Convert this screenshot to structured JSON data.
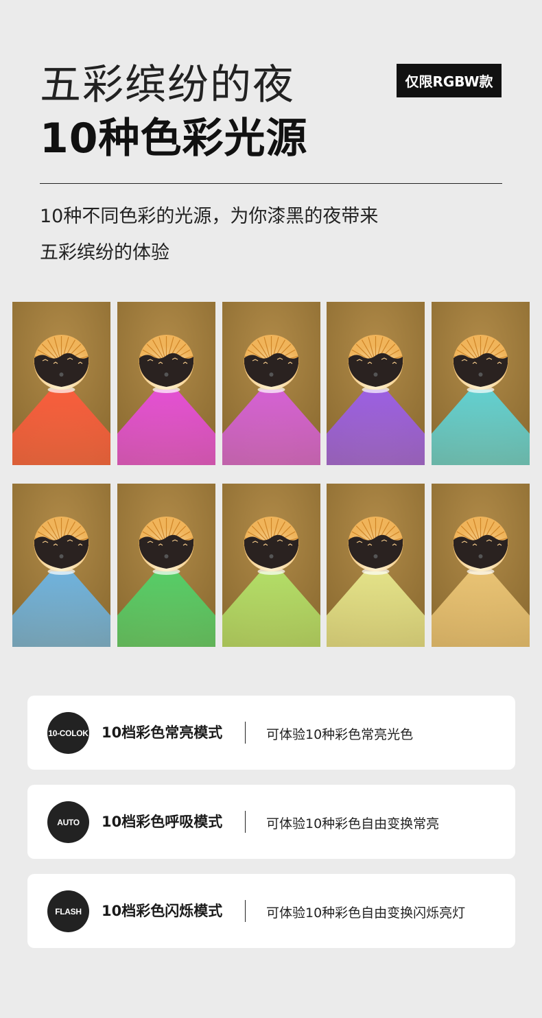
{
  "header": {
    "title_line1": "五彩缤纷的夜",
    "title_line2": "10种色彩光源",
    "badge": "仅限RGBW款"
  },
  "description": {
    "line1": "10种不同色彩的光源，为你漆黑的夜带来",
    "line2": "五彩缤纷的体验"
  },
  "color_samples": [
    {
      "color": "#ff5a3c"
    },
    {
      "color": "#e94be0"
    },
    {
      "color": "#d85ee0"
    },
    {
      "color": "#9a5cf0"
    },
    {
      "color": "#5cd6dc"
    },
    {
      "color": "#6ab6ea"
    },
    {
      "color": "#4fd36a"
    },
    {
      "color": "#b3e56a"
    },
    {
      "color": "#e8ea8e"
    },
    {
      "color": "#eec878"
    }
  ],
  "modes": [
    {
      "icon_label": "10-COLOK",
      "name": "10档彩色常亮模式",
      "description": "可体验10种彩色常亮光色"
    },
    {
      "icon_label": "AUTO",
      "name": "10档彩色呼吸模式",
      "description": "可体验10种彩色自由变换常亮"
    },
    {
      "icon_label": "FLASH",
      "name": "10档彩色闪烁模式",
      "description": "可体验10种彩色自由变换闪烁亮灯"
    }
  ]
}
